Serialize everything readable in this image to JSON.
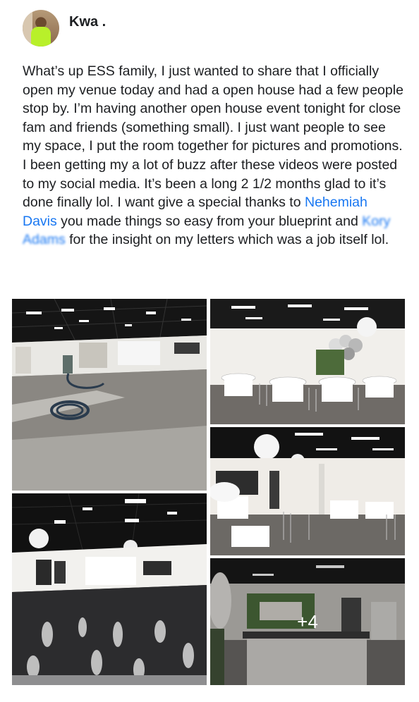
{
  "post": {
    "author": "Kwa .",
    "text_before": "What’s up ESS family, I just wanted to share that I officially open my venue today and had a open house had a few people stop by. I’m having another open house event tonight for close fam and friends (something small). I just want people to see my space, I put the room together for pictures and promotions. I been getting my a lot of buzz after these videos were posted to my social media. It’s been a long 2 1/2 months glad to it’s done finally lol. I want give a special thanks to ",
    "mention_1": "Nehemiah Davis",
    "text_middle": " you made things so easy from your blueprint and ",
    "mention_2": "Kory Adams",
    "text_after": " for the insight on my letters which was a job itself lol."
  },
  "photos": {
    "more_count": "+4"
  },
  "colors": {
    "link": "#1877f2",
    "text": "#1c1e21"
  }
}
